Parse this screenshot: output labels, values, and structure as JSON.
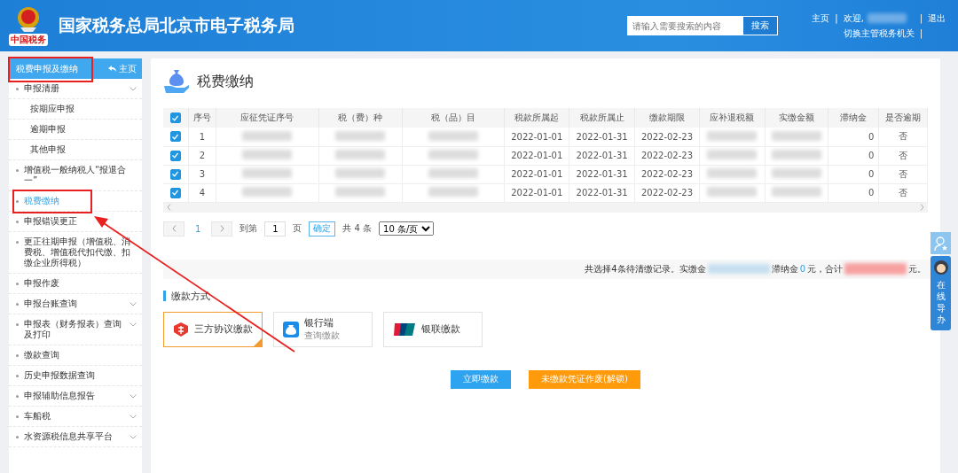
{
  "header": {
    "title": "国家税务总局北京市电子税务局",
    "logo_caption": "中国税务",
    "search": {
      "placeholder": "请输入需要搜索的内容",
      "button": "搜索"
    },
    "links": [
      "主页",
      "欢迎,",
      "退出"
    ],
    "switch_link": "切换主管税务机关",
    "separators": [
      "|",
      "|",
      "|"
    ]
  },
  "sidebar": {
    "section": "税费申报及缴纳",
    "home": "主页",
    "items": [
      {
        "label": "申报清册",
        "expandable": true,
        "expanded": true,
        "selected": false,
        "children": [
          {
            "label": "按期应申报",
            "selected": false
          },
          {
            "label": "逾期申报",
            "selected": false
          },
          {
            "label": "其他申报",
            "selected": false
          }
        ]
      },
      {
        "label": "增值税一般纳税人“报退合一”",
        "expandable": false,
        "selected": false
      },
      {
        "label": "税费缴纳",
        "expandable": false,
        "selected": true
      },
      {
        "label": "申报错误更正",
        "expandable": false,
        "selected": false
      },
      {
        "label": "更正往期申报（增值税、消费税、增值税代扣代缴、扣缴企业所得税）",
        "expandable": false,
        "selected": false
      },
      {
        "label": "申报作废",
        "expandable": false,
        "selected": false
      },
      {
        "label": "申报台账查询",
        "expandable": true,
        "expanded": false,
        "selected": false
      },
      {
        "label": "申报表（财务报表）查询及打印",
        "expandable": true,
        "expanded": false,
        "selected": false
      },
      {
        "label": "缴款查询",
        "expandable": false,
        "selected": false
      },
      {
        "label": "历史申报数据查询",
        "expandable": false,
        "selected": false
      },
      {
        "label": "申报辅助信息报告",
        "expandable": true,
        "expanded": false,
        "selected": false
      },
      {
        "label": "车船税",
        "expandable": true,
        "expanded": false,
        "selected": false
      },
      {
        "label": "水资源税信息共享平台",
        "expandable": true,
        "expanded": false,
        "selected": false
      }
    ]
  },
  "page": {
    "title": "税费缴纳"
  },
  "table": {
    "all_checked": true,
    "columns": [
      "序号",
      "应征凭证序号",
      "税（费）种",
      "税（品）目",
      "税款所属起",
      "税款所属止",
      "缴款期限",
      "应补退税额",
      "实缴金额",
      "滞纳金",
      "是否逾期"
    ],
    "rows": [
      {
        "checked": true,
        "cells": [
          {
            "kind": "text",
            "text": "1"
          },
          {
            "kind": "redacted"
          },
          {
            "kind": "redacted"
          },
          {
            "kind": "redacted"
          },
          {
            "kind": "text",
            "text": "2022-01-01"
          },
          {
            "kind": "text",
            "text": "2022-01-31"
          },
          {
            "kind": "text",
            "text": "2022-02-23"
          },
          {
            "kind": "redacted"
          },
          {
            "kind": "redacted"
          },
          {
            "kind": "number",
            "text": "0"
          },
          {
            "kind": "text",
            "text": "否"
          }
        ]
      },
      {
        "checked": true,
        "cells": [
          {
            "kind": "text",
            "text": "2"
          },
          {
            "kind": "redacted"
          },
          {
            "kind": "redacted"
          },
          {
            "kind": "redacted"
          },
          {
            "kind": "text",
            "text": "2022-01-01"
          },
          {
            "kind": "text",
            "text": "2022-01-31"
          },
          {
            "kind": "text",
            "text": "2022-02-23"
          },
          {
            "kind": "redacted"
          },
          {
            "kind": "redacted"
          },
          {
            "kind": "number",
            "text": "0"
          },
          {
            "kind": "text",
            "text": "否"
          }
        ]
      },
      {
        "checked": true,
        "cells": [
          {
            "kind": "text",
            "text": "3"
          },
          {
            "kind": "redacted"
          },
          {
            "kind": "redacted"
          },
          {
            "kind": "redacted"
          },
          {
            "kind": "text",
            "text": "2022-01-01"
          },
          {
            "kind": "text",
            "text": "2022-01-31"
          },
          {
            "kind": "text",
            "text": "2022-02-23"
          },
          {
            "kind": "redacted"
          },
          {
            "kind": "redacted"
          },
          {
            "kind": "number",
            "text": "0"
          },
          {
            "kind": "text",
            "text": "否"
          }
        ]
      },
      {
        "checked": true,
        "cells": [
          {
            "kind": "text",
            "text": "4"
          },
          {
            "kind": "redacted"
          },
          {
            "kind": "redacted"
          },
          {
            "kind": "redacted"
          },
          {
            "kind": "text",
            "text": "2022-01-01"
          },
          {
            "kind": "text",
            "text": "2022-01-31"
          },
          {
            "kind": "text",
            "text": "2022-02-23"
          },
          {
            "kind": "redacted"
          },
          {
            "kind": "redacted"
          },
          {
            "kind": "number",
            "text": "0"
          },
          {
            "kind": "text",
            "text": "否"
          }
        ]
      }
    ]
  },
  "pagination": {
    "pages": [
      {
        "label": "1",
        "selected": true
      }
    ],
    "goto_label": "到第",
    "goto_value": "1",
    "page_unit": "页",
    "confirm": "确定",
    "total": "共 4 条",
    "page_size": "10 条/页"
  },
  "summary": {
    "lead": "共选择4条待清缴记录。实缴金",
    "penalty_label": "滞纳金",
    "penalty_value": "0",
    "mid": "元，合计",
    "tail": "元。"
  },
  "payment": {
    "title": "缴款方式",
    "methods": [
      {
        "kind": "agreement",
        "label": "三方协议缴款",
        "selected": true
      },
      {
        "kind": "bank",
        "label": "银行端",
        "sublabel": "查询缴款",
        "selected": false
      },
      {
        "kind": "unionpay",
        "label": "银联缴款",
        "selected": false
      }
    ]
  },
  "actions": [
    {
      "kind": "primary",
      "label": "立即缴款"
    },
    {
      "kind": "warning",
      "label": "未缴款凭证作废(解锁)"
    }
  ],
  "side_widget": {
    "label": "在线导办"
  }
}
